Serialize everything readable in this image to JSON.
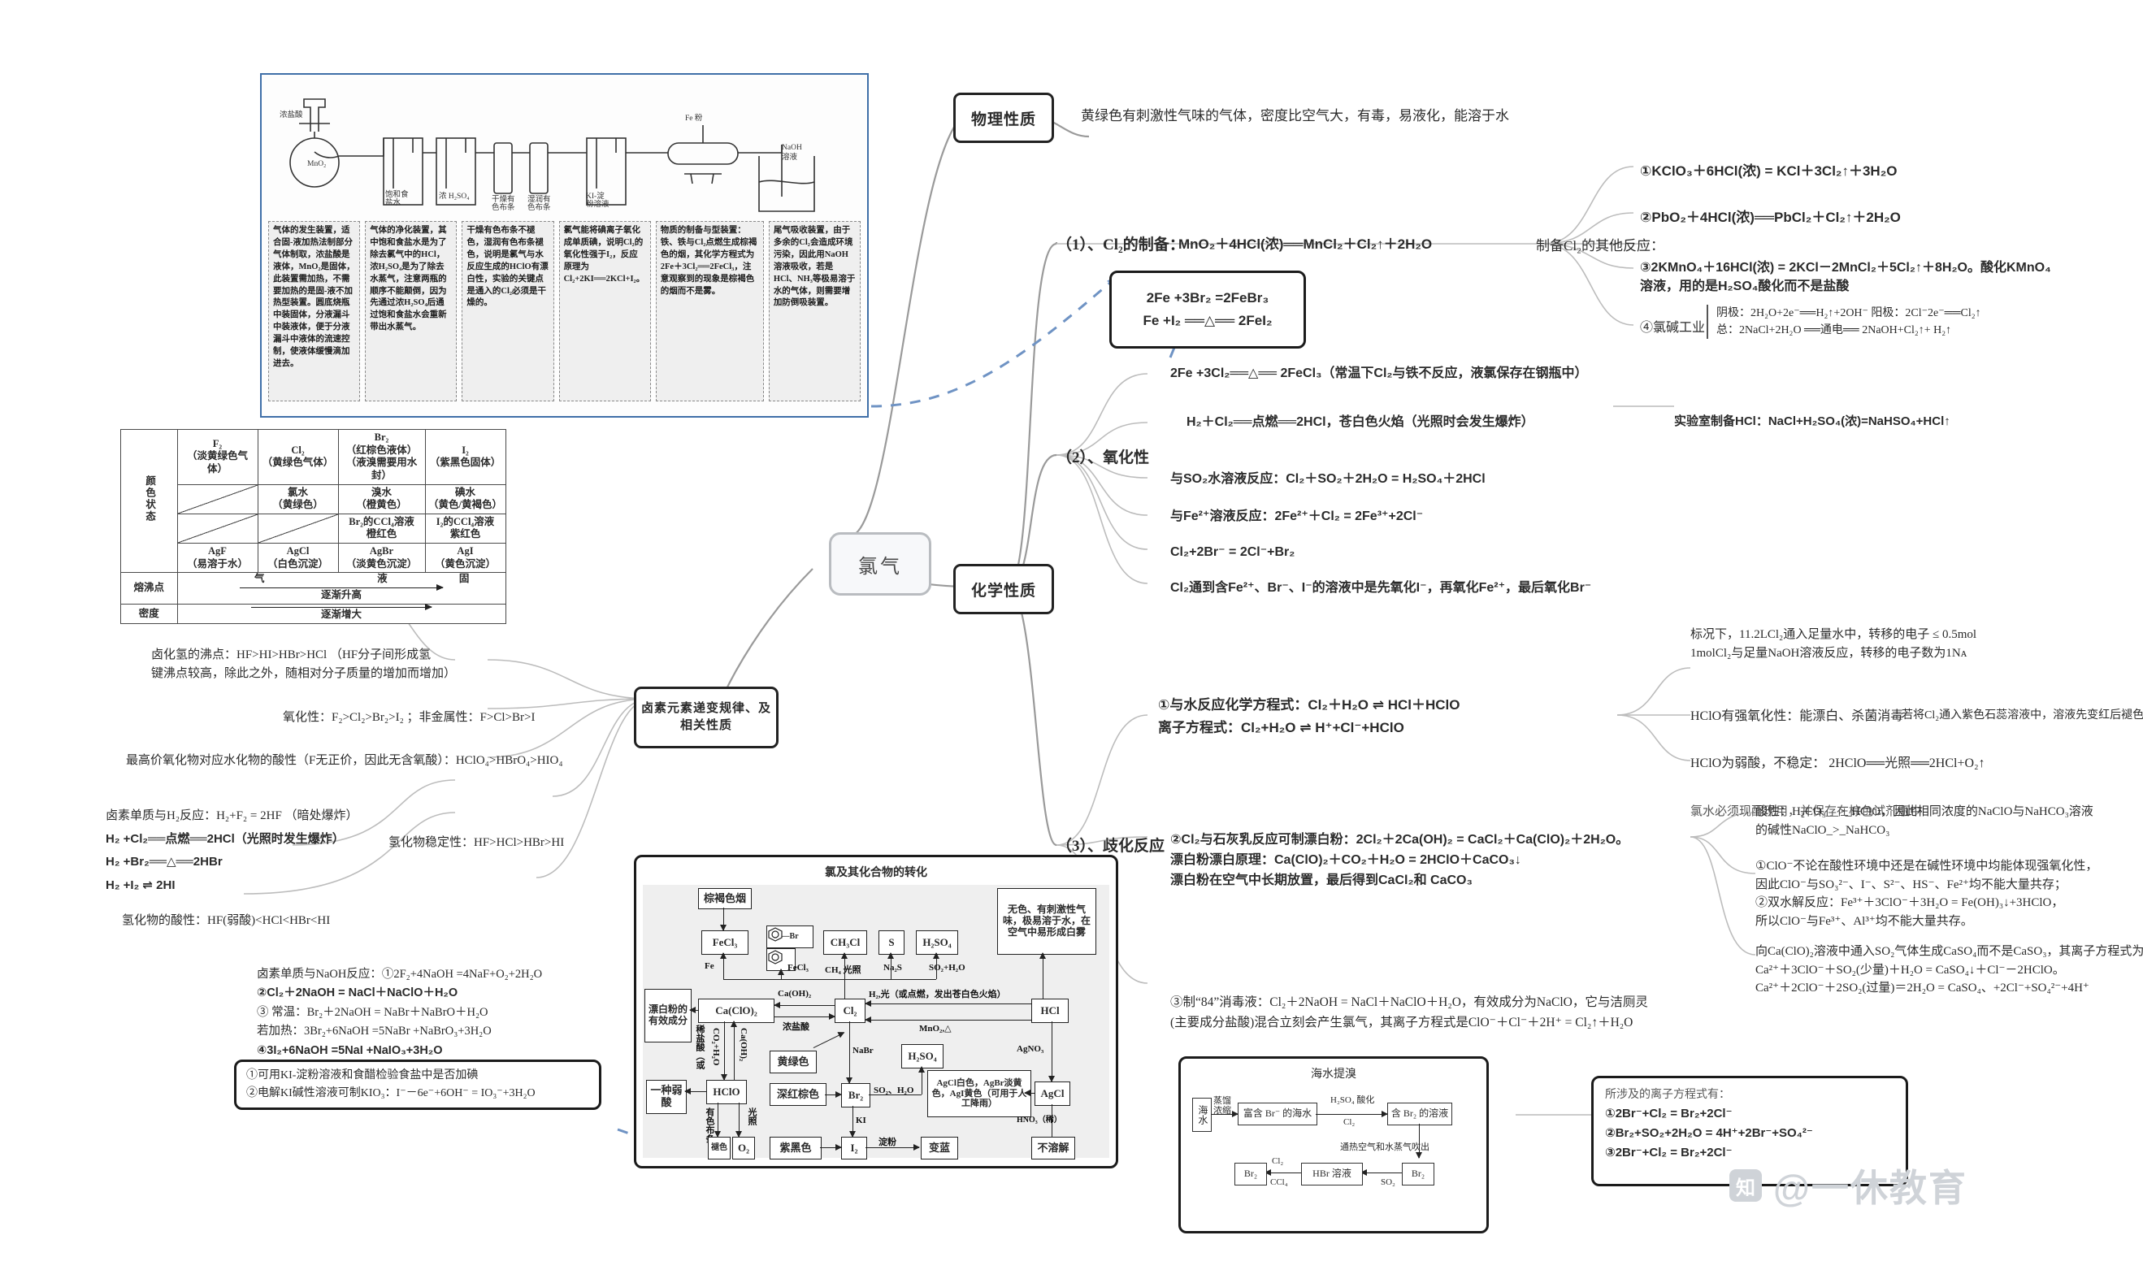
{
  "center": {
    "label": "氯气"
  },
  "branches": {
    "physical": "物理性质",
    "chemical": "化学性质",
    "halogen_laws": "卤素元素递变规律、及相关性质"
  },
  "physical_text": "黄绿色有刺激性气味的气体，密度比空气大，有毒，易液化，能溶于水",
  "prep": {
    "title": "（1）、Cl₂的制备：",
    "equation": "MnO₂＋4HCl(浓)══MnCl₂＋Cl₂↑＋2H₂O",
    "equation_cond": "△",
    "others_label": "制备Cl₂的其他反应：",
    "others": [
      "①KClO₃＋6HCl(浓) = KCl＋3Cl₂↑＋3H₂O",
      "②PbO₂＋4HCl(浓)══PbCl₂＋Cl₂↑＋2H₂O",
      "③2KMnO₄＋16HCl(浓) = 2KCl－2MnCl₂＋5Cl₂↑＋8H₂O。酸化KMnO₄溶液，用的是H₂SO₄酸化而不是盐酸"
    ],
    "chloralkali_label": "④氯碱工业",
    "chloralkali": [
      "阴极：2H₂O+2e⁻══H₂↑+2OH⁻    阳极：2Cl⁻2e⁻══Cl₂↑",
      "总：2NaCl+2H₂O ══通电══ 2NaOH+Cl₂↑+ H₂↑"
    ]
  },
  "fe_box": [
    "2Fe +3Br₂ =2FeBr₃",
    "Fe +I₂ ══△══ 2FeI₂"
  ],
  "oxidizing": {
    "title": "（2）、氧化性",
    "items": [
      "2Fe +3Cl₂══△══ 2FeCl₃（常温下Cl₂与铁不反应，液氯保存在钢瓶中）",
      "H₂＋Cl₂══点燃══2HCl，苍白色火焰（光照时会发生爆炸）",
      "与SO₂水溶液反应：Cl₂＋SO₂＋2H₂O = H₂SO₄＋2HCl",
      "与Fe²⁺溶液反应：2Fe²⁺＋Cl₂ = 2Fe³⁺+2Cl⁻",
      "Cl₂+2Br⁻ = 2Cl⁻+Br₂",
      "Cl₂通到含Fe²⁺、Br⁻、I⁻的溶液中是先氧化I⁻，再氧化Fe²⁺，最后氧化Br⁻"
    ],
    "hcl_lab": "实验室制备HCl：NaCl+H₂SO₄(浓)=NaHSO₄+HCl↑"
  },
  "disproportionation": {
    "title": "（3）、歧化反应",
    "item1": [
      "①与水反应化学方程式：Cl₂＋H₂O ⇌ HCl＋HClO",
      "离子方程式：Cl₂+H₂O ⇌ H⁺+Cl⁻+HClO"
    ],
    "note_electron": [
      "标况下，11.2LCl₂通入足量水中，转移的电子 ≤ 0.5mol",
      "1molCl₂与足量NaOH溶液反应，转移的电子数为1Nᴀ"
    ],
    "hclo_strong": "HClO有强氧化性：能漂白、杀菌消毒",
    "hclo_strong_note": "若将Cl₂通入紫色石蕊溶液中，溶液先变红后褪色",
    "hclo_weak": "HClO为弱酸，不稳定：  2HClO══光照══2HCl+O₂↑",
    "chlorine_water_note": "氯水必须现配现用，并保存在棕色试剂瓶中",
    "acidity_note": [
      "酸性：H₂CO₃__>_HClO，因此相同浓度的NaClO与NaHCO₃溶液",
      "的碱性NaClO_>_NaHCO₃"
    ],
    "clo_notes": [
      "①ClO⁻不论在酸性环境中还是在碱性环境中均能体现强氧化性，",
      "因此ClO⁻与SO₃²⁻、I⁻、S²⁻、HS⁻、Fe²⁺均不能大量共存；",
      "②双水解反应：Fe³⁺＋3ClO⁻＋3H₂O = Fe(OH)₃↓+3HClO，",
      "所以ClO⁻与Fe³⁺、Al³⁺均不能大量共存。"
    ],
    "caclo_notes": [
      "向Ca(ClO)₂溶液中通入SO₂气体生成CaSO₄而不是CaSO₃，其离子方程式为",
      "Ca²⁺＋3ClO⁻＋SO₂(少量)＋H₂O = CaSO₄↓＋Cl⁻－2HClO。",
      "Ca²⁺＋2ClO⁻＋2SO₂(过量)＝2H₂O = CaSO₄、+2Cl⁻+SO₄²⁻+4H⁺"
    ],
    "item2": [
      "②Cl₂与石灰乳反应可制漂白粉：2Cl₂＋2Ca(OH)₂ = CaCl₂＋Ca(ClO)₂＋2H₂O。",
      "漂白粉漂白原理：Ca(ClO)₂＋CO₂＋H₂O = 2HClO＋CaCO₃↓",
      "漂白粉在空气中长期放置，最后得到CaCl₂和 CaCO₃"
    ],
    "item3": [
      "③制“84”消毒液：Cl₂＋2NaOH = NaCl＋NaClO＋H₂O，有效成分为NaClO，它与洁厕灵",
      "(主要成分盐酸)混合立刻会产生氯气，其离子方程式是ClO⁻＋Cl⁻＋2H⁺ = Cl₂↑＋H₂O"
    ]
  },
  "halogen_table": {
    "row_labels": [
      "颜色状态",
      "熔沸点",
      "密度"
    ],
    "header": [
      [
        "F₂",
        "（淡黄绿色气体）"
      ],
      [
        "Cl₂",
        "（黄绿色气体）"
      ],
      [
        "Br₂",
        "（红棕色液体）",
        "（液溴需要用水封）"
      ],
      [
        "I₂",
        "（紫黑色固体）"
      ]
    ],
    "row_water": [
      "",
      "氯水\n（黄绿色）",
      "溴水\n（橙黄色）",
      "碘水\n（黄色/黄褐色）"
    ],
    "row_ccl4": [
      "",
      "",
      "Br₂的CCl₄溶液\n橙红色",
      "I₂的CCl₄溶液\n紫红色"
    ],
    "row_ag": [
      "AgF\n（易溶于水）",
      "AgCl\n（白色沉淀）",
      "AgBr\n（淡黄色沉淀）",
      "AgI\n（黄色沉淀）"
    ],
    "mp_states": [
      "气",
      "液",
      "固"
    ],
    "mp_trend": "逐渐升高",
    "density_trend": "逐渐增大"
  },
  "halogen_notes": {
    "hx_bp": [
      "卤化氢的沸点：HF>HI>HBr>HCl  （HF分子间形成氢",
      "键沸点较高，除此之外，随相对分子质量的增加而增加）"
    ],
    "oxidizing": "氧化性：F₂>Cl₂>Br₂>I₂ ；非金属性：F>Cl>Br>I",
    "highest_oxide_acid": "最高价氧化物对应水化物的酸性（F无正价，因此无含氧酸）：HClO₄>HBrO₄>HIO₄",
    "h2_reactions": [
      "卤素单质与H₂反应：H₂+F₂ = 2HF （暗处爆炸）",
      "H₂ +Cl₂══点燃══2HCl（光照时发生爆炸）",
      "H₂ +Br₂══△══2HBr",
      "H₂ +I₂ ⇌ 2HI"
    ],
    "hydride_stability": "氢化物稳定性：HF>HCl>HBr>HI",
    "hydride_acidity": "氢化物的酸性：HF(弱酸)<HCl<HBr<HI",
    "naoh_reactions": [
      "卤素单质与NaOH反应：①2F₂+4NaOH =4NaF+O₂+2H₂O",
      "②Cl₂＋2NaOH = NaCl＋NaClO＋H₂O",
      "③ 常温：Br₂＋2NaOH = NaBr＋NaBrO＋H₂O",
      "若加热：3Br₂+6NaOH =5NaBr +NaBrO₃+3H₂O",
      "④3I₂+6NaOH =5NaI +NaIO₃+3H₂O"
    ],
    "ki_box": [
      "①可用KI-淀粉溶液和食醋检验食盐中是否加碘",
      "②电解KI碱性溶液可制KIO₃：I⁻－6e⁻+6OH⁻ = IO₃⁻+3H₂O"
    ]
  },
  "apparatus": {
    "labels": [
      "浓盐酸",
      "MnO₂",
      "饱和食盐水",
      "浓 H₂SO₄",
      "干燥有色布条",
      "湿润有色布条",
      "KI-淀粉溶液",
      "Fe 粉",
      "NaOH 溶液"
    ],
    "captions": [
      "气体的发生装置，适合固-液加热法制部分气体制取，浓盐酸是液体，MnO₂是固体，此装置需加热，不需要加热的是固-液不加热型装置。圆底烧瓶中装固体，分液漏斗中装液体，便于分液漏斗中液体的流速控制，使液体缓慢滴加进去。",
      "气体的净化装置，其中饱和食盐水是为了除去氯气中的HCl，浓H₂SO₄是为了除去水蒸气，注意两瓶的顺序不能颠倒，因为先通过浓H₂SO₄后通过饱和食盐水会重新带出水蒸气。",
      "干燥有色布条不褪色，湿润有色布条褪色，说明是氯气与水反应生成的HClO有漂白性，实验的关键点是通入的Cl₂必须是干燥的。",
      "氯气能将碘离子氧化成单质碘，说明Cl₂的氧化性强于I₂，反应原理为Cl₂+2KI══2KCl+I₂。",
      "物质的制备与型装置：铁、铁与Cl₂点燃生成棕褐色的烟，其化学方程式为2Fe＋3Cl₂══2FeCl₃，注意观察到的现象是棕褐色的烟而不是雾。",
      "尾气吸收装置，由于多余的Cl₂会造成环境污染，因此用NaOH溶液吸收，若是HCl、NH₃等极易溶于水的气体，则需要增加防倒吸装置。"
    ]
  },
  "transform": {
    "title": "氯及其化合物的转化",
    "boxes": {
      "brown_smoke": "棕褐色烟",
      "fecl3": "FeCl₃",
      "benzene_br": "—Br",
      "ch3cl": "CH₃Cl",
      "s": "S",
      "h2so4_top": "H₂SO₄",
      "hcl_note": "无色、有刺激性气味，极易溶于水，在空气中易形成白雾",
      "bleach_active": "漂白粉的有效成分",
      "caclo2": "Ca(ClO)₂",
      "cl2": "Cl₂",
      "hcl": "HCl",
      "yellow_green": "黄绿色",
      "weak_acid": "一种弱酸",
      "hclo": "HClO",
      "dark_red_brown": "深红棕色",
      "br2": "Br₂",
      "h2so4_mid": "H₂SO₄",
      "agcl_note": "AgCl白色，AgBr淡黄色，AgI黄色（可用于人工降雨）",
      "agcl": "AgCl",
      "fade": "褪色",
      "o2": "O₂",
      "purple_black": "紫黑色",
      "i2": "I₂",
      "starch_blue": "变蓝",
      "insoluble": "不溶解"
    },
    "edge_labels": {
      "fe": "Fe",
      "fecl3": "FeCl₃",
      "ch4_light": "CH₄ 光照",
      "na2s": "Na₂S",
      "so2_h2o": "SO₂+H₂O",
      "caoh2_top": "Ca(OH)₂",
      "h2_light": "H₂,光（或点燃，发出苍白色火焰）",
      "conc_hcl": "浓盐酸",
      "mno2_heat": "MnO₂,△",
      "dilute_hcl": "稀盐酸（或",
      "co2_h2o": "CO₂+H₂O",
      "caoh2_side": "Ca(OH)₂",
      "nabr": "NaBr",
      "so2_h2o2": "SO₂、H₂O",
      "agno3": "AgNO₃",
      "hno3": "HNO₃（稀）",
      "colored_cloth": "有色布条",
      "light": "光照",
      "ki": "KI",
      "starch": "淀粉"
    }
  },
  "bromine": {
    "title": "海水提溴",
    "nodes": [
      "海水",
      "富含 Br⁻ 的海水",
      "含 Br₂ 的溶液",
      "Br₂",
      "HBr 溶液",
      "Br₂"
    ],
    "labels": [
      "蒸馏浓缩",
      "H₂SO₄ 酸化",
      "Cl₂",
      "通热空气和水蒸气吹出",
      "Cl₂",
      "CCl₄",
      "SO₂"
    ],
    "ion_eq_title": "所涉及的离子方程式有：",
    "ion_eqs": [
      "①2Br⁻+Cl₂ = Br₂+2Cl⁻",
      "②Br₂+SO₂+2H₂O = 4H⁺+2Br⁻+SO₄²⁻",
      "③2Br⁻+Cl₂ = Br₂+2Cl⁻"
    ]
  },
  "watermark": {
    "text": "@一休教育",
    "logo": "知"
  }
}
